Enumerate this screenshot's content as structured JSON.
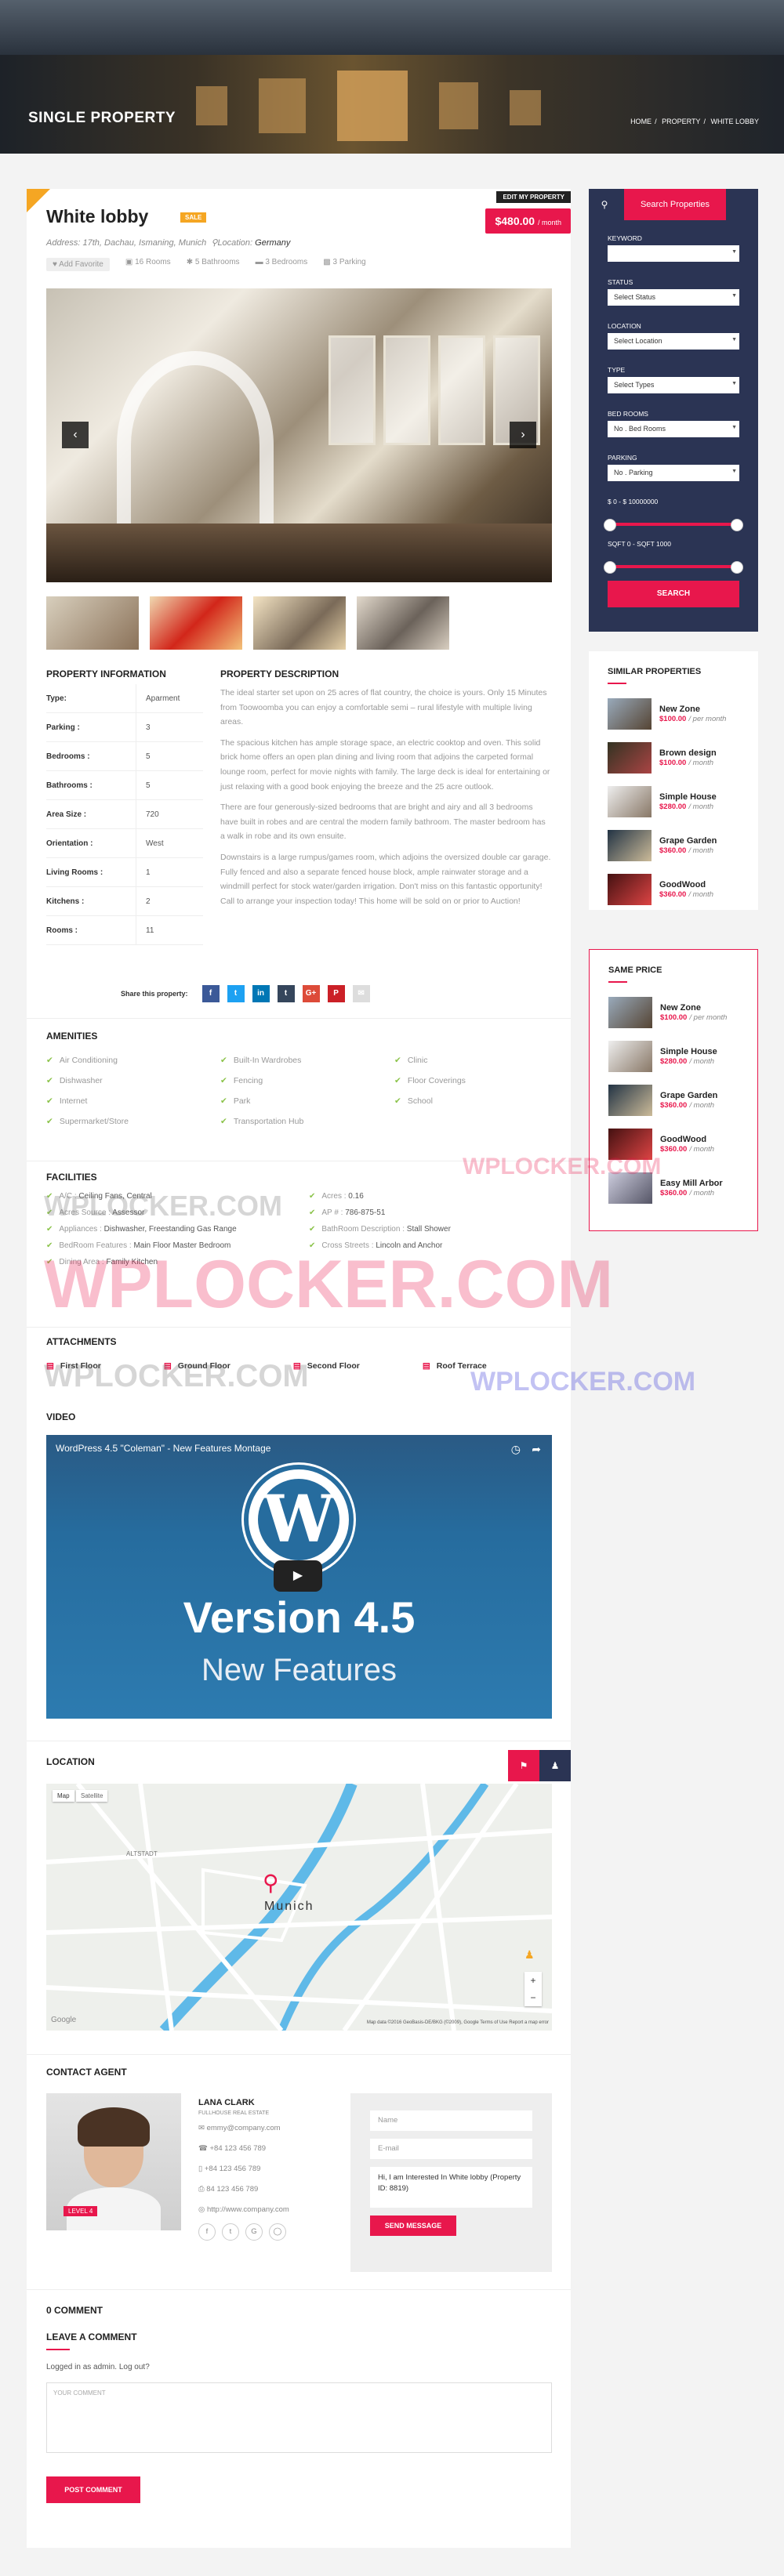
{
  "hero": {
    "title": "SINGLE PROPERTY",
    "crumbs": [
      "HOME",
      "PROPERTY",
      "WHITE LOBBY"
    ],
    "sep": "/"
  },
  "property": {
    "edit_label": "EDIT MY PROPERTY",
    "title": "White lobby",
    "badge": "SALE",
    "price": "$480.00",
    "price_unit": "/ month",
    "address_label": "Address:",
    "address": "17th, Dachau, Ismaning, Munich",
    "location_label": "Location:",
    "location": "Germany",
    "favorite": "Add Favorite",
    "rooms": "16 Rooms",
    "baths": "5 Bathrooms",
    "beds": "3 Bedrooms",
    "parking": "3 Parking"
  },
  "info": {
    "heading": "PROPERTY INFORMATION",
    "rows": [
      [
        "Type:",
        "Aparment"
      ],
      [
        "Parking :",
        "3"
      ],
      [
        "Bedrooms :",
        "5"
      ],
      [
        "Bathrooms :",
        "5"
      ],
      [
        "Area Size :",
        "720"
      ],
      [
        "Orientation :",
        "West"
      ],
      [
        "Living Rooms :",
        "1"
      ],
      [
        "Kitchens :",
        "2"
      ],
      [
        "Rooms :",
        "11"
      ]
    ]
  },
  "description": {
    "heading": "PROPERTY DESCRIPTION",
    "paragraphs": [
      "The ideal starter set upon on 25 acres of flat country, the choice is yours. Only 15 Minutes from Toowoomba you can enjoy a comfortable semi – rural lifestyle with multiple living areas.",
      "The spacious kitchen has ample storage space, an electric cooktop and oven. This solid brick home offers an open plan dining and living room that adjoins the carpeted formal lounge room, perfect for movie nights with family. The large deck is ideal for entertaining or just relaxing with a good book enjoying the breeze and the 25 acre outlook.",
      "There are four generously-sized bedrooms that are bright and airy and all 3 bedrooms have built in robes and are central the modern family bathroom. The master bedroom has a walk in robe and its own ensuite.",
      "Downstairs is a large rumpus/games room, which adjoins the oversized double car garage. Fully fenced and also a separate fenced house block, ample rainwater storage and a windmill perfect for stock water/garden irrigation. Don't miss on this fantastic opportunity! Call to arrange your inspection today! This home will be sold on or prior to Auction!"
    ]
  },
  "share": {
    "label": "Share this property:",
    "icons": [
      "f",
      "t",
      "in",
      "t",
      "G+",
      "P",
      "✉"
    ]
  },
  "amenities": {
    "heading": "AMENITIES",
    "items": [
      "Air Conditioning",
      "Built-In Wardrobes",
      "Clinic",
      "Dishwasher",
      "Fencing",
      "Floor Coverings",
      "Internet",
      "Park",
      "School",
      "Supermarket/Store",
      "Transportation Hub"
    ]
  },
  "facilities": {
    "heading": "FACILITIES",
    "items": [
      [
        "A/C :",
        "Ceiling Fans, Central"
      ],
      [
        "Acres :",
        "0.16"
      ],
      [
        "Acres Source :",
        "Assessor"
      ],
      [
        "AP # :",
        "786-875-51"
      ],
      [
        "Appliances :",
        "Dishwasher, Freestanding Gas Range"
      ],
      [
        "BathRoom Description :",
        "Stall Shower"
      ],
      [
        "BedRoom Features :",
        "Main Floor Master Bedroom"
      ],
      [
        "Cross Streets :",
        "Lincoln and Anchor"
      ],
      [
        "Dining Area :",
        "Family Kitchen"
      ]
    ]
  },
  "attachments": {
    "heading": "ATTACHMENTS",
    "items": [
      "First Floor",
      "Ground Floor",
      "Second Floor",
      "Roof Terrace"
    ]
  },
  "video": {
    "heading": "VIDEO",
    "title": "WordPress 4.5 \"Coleman\" - New Features Montage",
    "big": "Version 4.5",
    "sub": "New Features"
  },
  "location": {
    "heading": "LOCATION",
    "map_tab": "Map",
    "sat_tab": "Satellite",
    "city": "Munich",
    "district": "ALTSTADT",
    "footer": "Map data ©2016 GeoBasis-DE/BKG (©2009), Google   Terms of Use   Report a map error",
    "google": "Google"
  },
  "agent": {
    "heading": "CONTACT AGENT",
    "name": "LANA CLARK",
    "company": "FULLHOUSE REAL ESTATE",
    "level": "LEVEL 4",
    "email": "emmy@company.com",
    "phone1": "+84 123 456 789",
    "phone2": "+84 123 456 789",
    "fax": "84 123 456 789",
    "web": "http://www.company.com"
  },
  "form": {
    "name": "Name",
    "email": "E-mail",
    "message": "Hi, I am Interested In White lobby (Property ID: 8819)",
    "button": "SEND MESSAGE"
  },
  "comments": {
    "count": "0 COMMENT",
    "leave": "LEAVE A COMMENT",
    "logged": "Logged in as admin. Log out?",
    "placeholder": "YOUR COMMENT",
    "button": "POST COMMENT"
  },
  "search": {
    "tab": "Search Properties",
    "keyword": "KEYWORD",
    "status": "STATUS",
    "status_val": "Select Status",
    "location": "LOCATION",
    "location_val": "Select Location",
    "type": "TYPE",
    "type_val": "Select Types",
    "bed": "BED ROOMS",
    "bed_val": "No . Bed Rooms",
    "parking": "PARKING",
    "parking_val": "No . Parking",
    "price_range": "$ 0 - $ 10000000",
    "sqft_range": "SQFT 0 - SQFT 1000",
    "button": "SEARCH"
  },
  "similar": {
    "heading": "SIMILAR PROPERTIES",
    "items": [
      [
        "New Zone",
        "$100.00",
        "/ per month"
      ],
      [
        "Brown design",
        "$100.00",
        "/ month"
      ],
      [
        "Simple House",
        "$280.00",
        "/ month"
      ],
      [
        "Grape Garden",
        "$360.00",
        "/ month"
      ],
      [
        "GoodWood",
        "$360.00",
        "/ month"
      ]
    ]
  },
  "same": {
    "heading": "SAME PRICE",
    "items": [
      [
        "New Zone",
        "$100.00",
        "/ per month"
      ],
      [
        "Simple House",
        "$280.00",
        "/ month"
      ],
      [
        "Grape Garden",
        "$360.00",
        "/ month"
      ],
      [
        "GoodWood",
        "$360.00",
        "/ month"
      ],
      [
        "Easy Mill Arbor",
        "$360.00",
        "/ month"
      ]
    ]
  },
  "watermark": {
    "text": "WPLOCKER.COM"
  },
  "colors": {
    "accent": "#e8174c",
    "navy": "#2b3454",
    "check": "#8bc34a"
  }
}
